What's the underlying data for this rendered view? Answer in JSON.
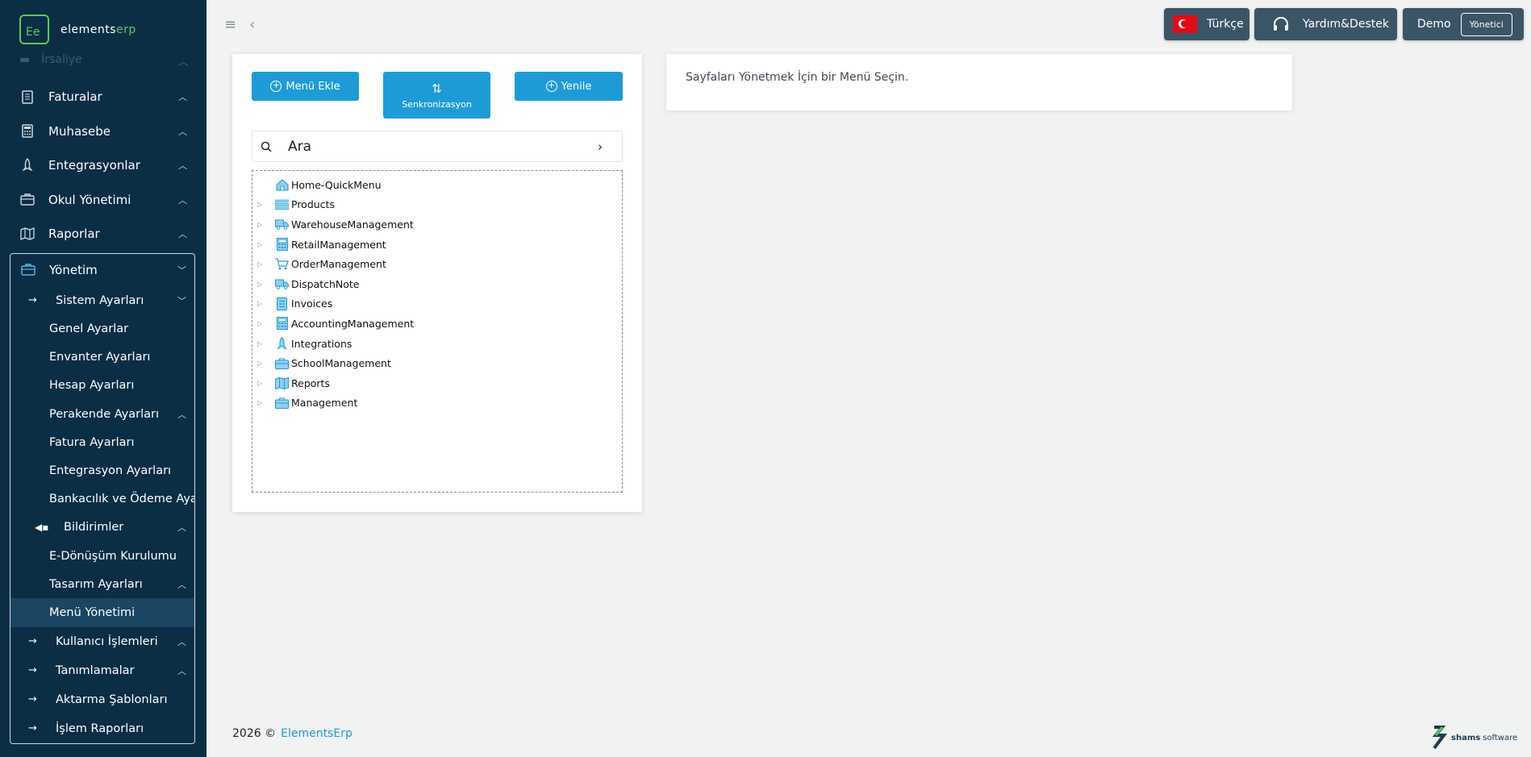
{
  "brand": {
    "logo_mark": "Ee",
    "name_a": "elements",
    "name_b": "erp"
  },
  "sidebar": {
    "ghost_item": "İrsaliye",
    "items": [
      {
        "label": "Faturalar",
        "icon": "invoice-icon"
      },
      {
        "label": "Muhasebe",
        "icon": "calculator-icon"
      },
      {
        "label": "Entegrasyonlar",
        "icon": "rocket-icon"
      },
      {
        "label": "Okul Yönetimi",
        "icon": "briefcase-icon"
      },
      {
        "label": "Raporlar",
        "icon": "map-icon"
      }
    ],
    "group": {
      "label": "Yönetim",
      "system_settings": "Sistem Ayarları",
      "settings": [
        "Genel Ayarlar",
        "Envanter Ayarları",
        "Hesap Ayarları",
        "Perakende Ayarları",
        "Fatura Ayarları",
        "Entegrasyon Ayarları",
        "Bankacılık ve Ödeme Ayarları",
        "Bildirimler",
        "E-Dönüşüm Kurulumu",
        "Tasarım Ayarları",
        "Menü Yönetimi"
      ],
      "others": [
        "Kullanıcı İşlemleri",
        "Tanımlamalar",
        "Aktarma Şablonları",
        "İşlem Raporları"
      ]
    }
  },
  "header": {
    "language": "Türkçe",
    "help": "Yardım&Destek",
    "user": "Demo",
    "role": "Yönetici"
  },
  "menu_panel": {
    "add_label": "Menü Ekle",
    "sync_label": "Senkronizasyon",
    "refresh_label": "Yenile",
    "search_placeholder": "Ara",
    "tree": [
      {
        "label": "Home-QuickMenu",
        "icon": "home-icon",
        "expandable": false
      },
      {
        "label": "Products",
        "icon": "list-icon",
        "expandable": true
      },
      {
        "label": "WarehouseManagement",
        "icon": "truck-icon",
        "expandable": true
      },
      {
        "label": "RetailManagement",
        "icon": "calculator-icon",
        "expandable": true
      },
      {
        "label": "OrderManagement",
        "icon": "cart-icon",
        "expandable": true
      },
      {
        "label": "DispatchNote",
        "icon": "truck-icon",
        "expandable": true
      },
      {
        "label": "Invoices",
        "icon": "invoice-icon",
        "expandable": true
      },
      {
        "label": "AccountingManagement",
        "icon": "calculator-icon",
        "expandable": true
      },
      {
        "label": "Integrations",
        "icon": "rocket-icon",
        "expandable": true
      },
      {
        "label": "SchoolManagement",
        "icon": "briefcase-icon",
        "expandable": true
      },
      {
        "label": "Reports",
        "icon": "map-icon",
        "expandable": true
      },
      {
        "label": "Management",
        "icon": "briefcase-icon",
        "expandable": true
      }
    ]
  },
  "info_panel": {
    "message": "Sayfaları Yönetmek İçin bir Menü Seçin."
  },
  "footer": {
    "copyright": "2026 ©",
    "brand": "ElementsErp",
    "vendor_a": "shams",
    "vendor_b": "software"
  },
  "colors": {
    "sidebar_bg": "#0b2e45",
    "accent": "#1e9bd7",
    "brand_green": "#5ec95a",
    "header_btn": "#3c5566"
  }
}
